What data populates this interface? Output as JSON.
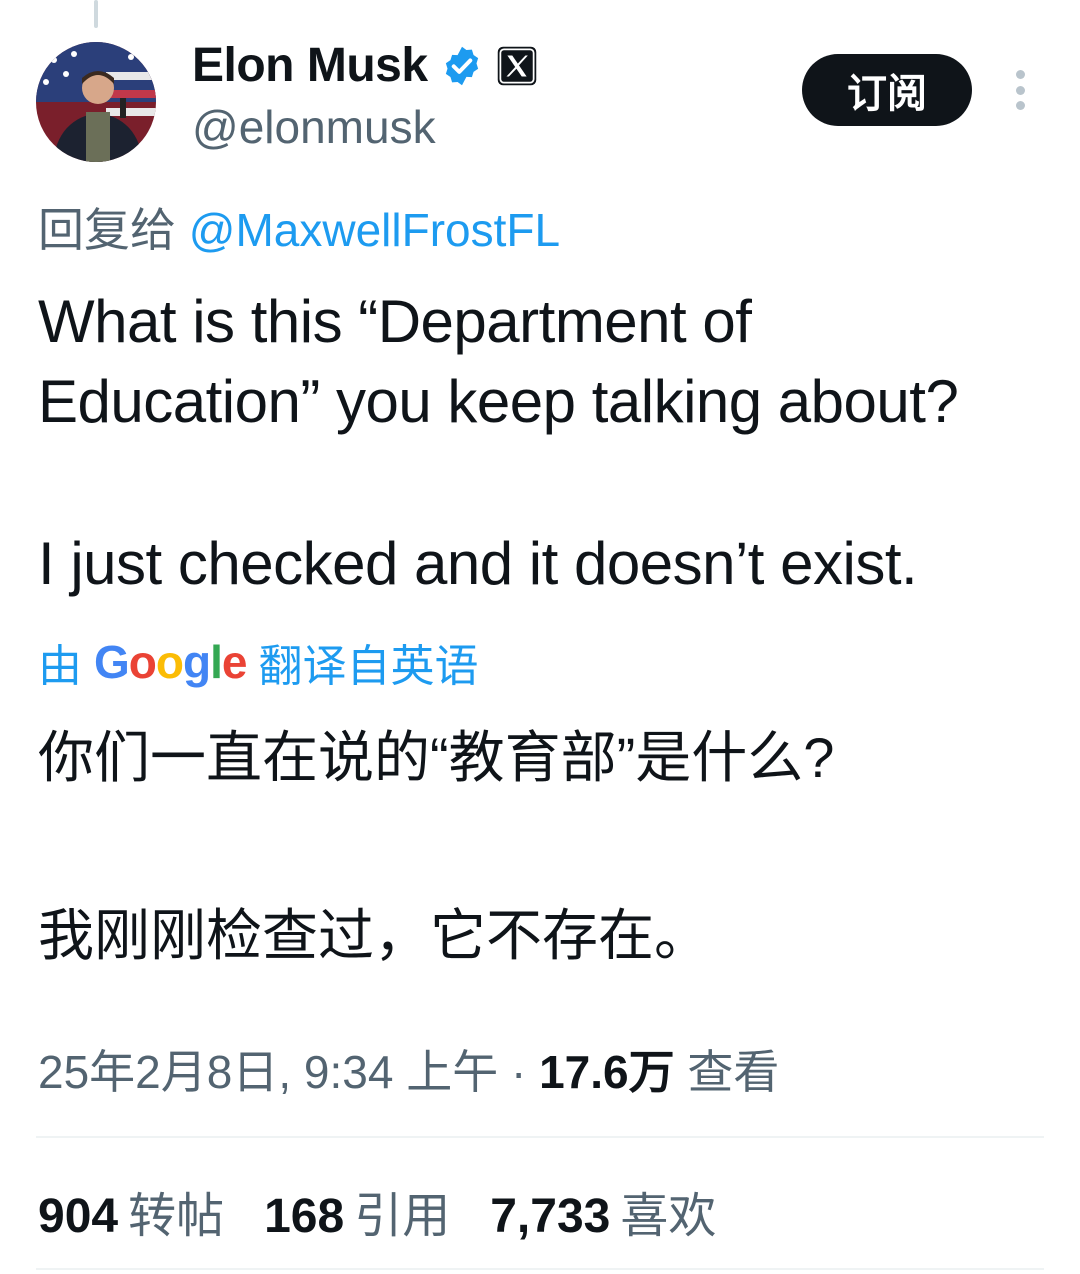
{
  "header": {
    "display_name": "Elon Musk",
    "handle": "@elonmusk",
    "subscribe_label": "订阅"
  },
  "reply": {
    "prefix": "回复给",
    "mention": "@MaxwellFrostFL"
  },
  "tweet": {
    "line1": "What is this “Department of",
    "line2": "Education” you keep talking about?",
    "line3": "I just checked and it doesn’t exist."
  },
  "translation": {
    "by": "由",
    "google": [
      "G",
      "o",
      "o",
      "g",
      "l",
      "e"
    ],
    "suffix": "翻译自英语",
    "line1": "你们一直在说的“教育部”是什么?",
    "line2": "我刚刚检查过，它不存在。"
  },
  "meta": {
    "timestamp": "25年2月8日, 9:34 上午",
    "separator": " · ",
    "views_count": "17.6万",
    "views_label": "查看"
  },
  "stats": {
    "reposts_count": "904",
    "reposts_label": "转帖",
    "quotes_count": "168",
    "quotes_label": "引用",
    "likes_count": "7,733",
    "likes_label": "喜欢"
  },
  "colors": {
    "accent": "#1d9bf0",
    "secondary_text": "#536471",
    "primary_text": "#0f1419",
    "google_blue": "#4285f4",
    "google_red": "#ea4335",
    "google_yellow": "#fbbc05",
    "google_green": "#34a853"
  }
}
